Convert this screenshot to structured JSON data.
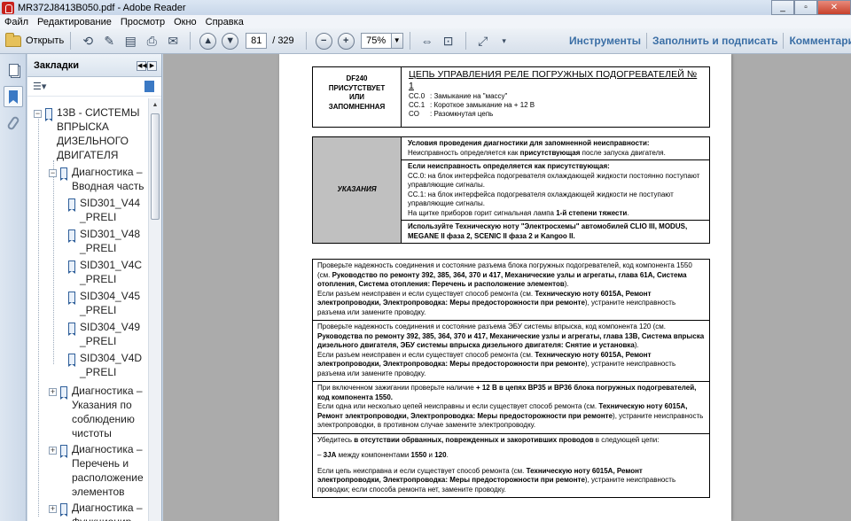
{
  "window": {
    "title": "MR372J8413B050.pdf - Adobe Reader"
  },
  "menu": [
    "Файл",
    "Редактирование",
    "Просмотр",
    "Окно",
    "Справка"
  ],
  "toolbar": {
    "open_label": "Открыть",
    "page_current": "81",
    "page_total": "/ 329",
    "zoom": "75%",
    "tools_label": "Инструменты",
    "fill_sign_label": "Заполнить и подписать",
    "comment_label": "Комментарии"
  },
  "bookmarks": {
    "header": "Закладки",
    "items": [
      {
        "label": "13В - СИСТЕМЫ ВПРЫСКА ДИЗЕЛЬНОГО ДВИГАТЕЛЯ",
        "expander": "−"
      },
      {
        "label": "Диагностика – Вводная часть",
        "expander": "−"
      },
      {
        "label": "SID301_V44_PRELI"
      },
      {
        "label": "SID301_V48_PRELI"
      },
      {
        "label": "SID301_V4C_PRELI"
      },
      {
        "label": "SID304_V45_PRELI"
      },
      {
        "label": "SID304_V49_PRELI"
      },
      {
        "label": "SID304_V4D_PRELI"
      },
      {
        "label": "Диагностика – Указания по соблюдению чистоты",
        "expander": "+"
      },
      {
        "label": "Диагностика – Перечень и расположение элементов",
        "expander": "+"
      },
      {
        "label": "Диагностика – Функционир…",
        "expander": "+"
      }
    ]
  },
  "document": {
    "header": {
      "code": "DF240",
      "status1": "ПРИСУТСТВУЕТ",
      "status2": "ИЛИ",
      "status3": "ЗАПОМНЕННАЯ",
      "title": "ЦЕПЬ УПРАВЛЕНИЯ РЕЛЕ ПОГРУЖНЫХ ПОДОГРЕВАТЕЛЕЙ № 1",
      "codes": [
        {
          "k": "CC.0",
          "v": ": Замыкание на \"массу\""
        },
        {
          "k": "CC.1",
          "v": ": Короткое замыкание на + 12 В"
        },
        {
          "k": "CO",
          "v": ": Разомкнутая цепь"
        }
      ]
    },
    "notes": {
      "label": "УКАЗАНИЯ",
      "cond_title": "Условия проведения диагностики для запомненной неисправности:",
      "cond_text_a": "Неисправность определяется как ",
      "cond_text_b": "присутствующая",
      "cond_text_c": " после запуска двигателя.",
      "present_title": "Если неисправность определяется как присутствующая:",
      "present_l1": "CC.0: на блок интерфейса подогревателя охлаждающей жидкости постоянно поступают управляющие сигналы.",
      "present_l2": "CC.1: на блок интерфейса подогревателя охлаждающей жидкости не поступают управляющие сигналы.",
      "present_l3a": "На щитке приборов горит сигнальная лампа ",
      "present_l3b": "1-й степени тяжести",
      "present_l3c": ".",
      "tech_note": "Используйте Техническую ноту \"Электросхемы\" автомобилей CLIO III, MODUS, MEGANE II фаза 2, SCENIC II фаза 2 и Kangoo II."
    },
    "steps": {
      "s1a": "Проверьте надежность соединения и состояние разъема блока погружных подогревателей, код компонента 1550 (см. ",
      "s1b": "Руководство по ремонту 392, 385, 364, 370 и 417, Механические узлы и агрегаты, глава 61A, Система отопления, Система отопления: Перечень и расположение элементов",
      "s1c": ").",
      "s1d": "Если разъем неисправен и если существует способ ремонта (см. ",
      "s1e": "Техническую ноту 6015A, Ремонт электропроводки, Электропроводка: Меры предосторожности при ремонте",
      "s1f": "), устраните неисправность разъема или замените проводку.",
      "s2a": "Проверьте надежность соединения и состояние разъема ЭБУ системы впрыска, код компонента 120 (см. ",
      "s2b": "Руководства по ремонту 392, 385, 364, 370 и 417, Механические узлы и агрегаты, глава 13B, Система впрыска дизельного двигателя, ЭБУ системы впрыска дизельного двигателя: Снятие и установка",
      "s2c": ").",
      "s2d": "Если разъем неисправен и если существует способ ремонта (см. ",
      "s2e": "Техническую ноту 6015A, Ремонт электропроводки, Электропроводка: Меры предосторожности при ремонте",
      "s2f": "), устраните неисправность разъема или замените проводку.",
      "s3a": "При включенном зажигании проверьте наличие ",
      "s3b": "+ 12 В в цепях BP35 и BP36 блока погружных подогревателей, код компонента 1550.",
      "s3c": "Если одна или несколько цепей неисправны и если существует способ ремонта (см. ",
      "s3d": "Техническую ноту 6015A, Ремонт электропроводки, Электропроводка: Меры предосторожности при ремонте",
      "s3e": "), устраните неисправность электропроводки, в противном случае замените электропроводку.",
      "s4a": "Убедитесь ",
      "s4b": "в отсутствии обрванных, поврежденных и закоротивших проводов",
      "s4c": " в следующей цепи:",
      "s4d": "– ",
      "s4e": "3JA",
      "s4f": " между компонентами ",
      "s4g": "1550",
      "s4h": " и ",
      "s4i": "120",
      "s4j": ".",
      "s4k": "Если цепь неисправна и если существует способ ремонта (см. ",
      "s4l": "Техническую ноту 6015A, Ремонт электропроводки, Электропроводка: Меры предосторожности при ремонте",
      "s4m": "), устраните неисправность проводки; если способа ремонта нет, замените проводку."
    }
  }
}
